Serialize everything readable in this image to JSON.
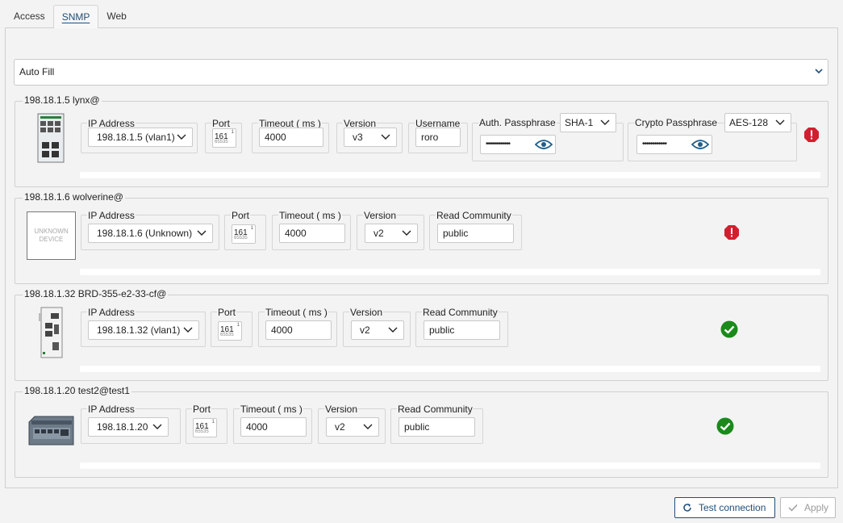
{
  "tabs": [
    {
      "label": "Access",
      "active": false
    },
    {
      "label": "SNMP",
      "active": true
    },
    {
      "label": "Web",
      "active": false
    }
  ],
  "autofill": {
    "label": "Auto Fill",
    "icon": "chevron-down-icon"
  },
  "labels": {
    "ip": "IP Address",
    "port": "Port",
    "timeout": "Timeout ( ms )",
    "version": "Version",
    "username": "Username",
    "auth": "Auth. Passphrase",
    "crypto": "Crypto Passphrase",
    "read_community": "Read Community"
  },
  "devices": [
    {
      "title": "198.18.1.5 lynx@",
      "ip": "198.18.1.5 (vlan1)",
      "port": "161",
      "port_min": "1",
      "port_max": "65535",
      "timeout": "4000",
      "version": "v3",
      "username": "roro",
      "auth_protocol": "SHA-1",
      "auth_pass": "••••••••••••",
      "crypto_protocol": "AES-128",
      "crypto_pass": "••••••••••••",
      "status": "error",
      "image": "switch-lynx-image"
    },
    {
      "title": "198.18.1.6 wolverine@",
      "ip": "198.18.1.6 (Unknown)",
      "port": "161",
      "port_min": "1",
      "port_max": "65535",
      "timeout": "4000",
      "version": "v2",
      "read_community": "public",
      "status": "error",
      "image": "unknown-device-image",
      "image_text": [
        "UNKNOWN",
        "DEVICE"
      ]
    },
    {
      "title": "198.18.1.32 BRD-355-e2-33-cf@",
      "ip": "198.18.1.32 (vlan1)",
      "port": "161",
      "port_min": "1",
      "port_max": "65535",
      "timeout": "4000",
      "version": "v2",
      "read_community": "public",
      "status": "ok",
      "image": "din-rail-device-image"
    },
    {
      "title": "198.18.1.20 test2@test1",
      "ip": "198.18.1.20",
      "port": "161",
      "port_min": "1",
      "port_max": "65535",
      "timeout": "4000",
      "version": "v2",
      "read_community": "public",
      "status": "ok",
      "image": "rugged-device-image"
    }
  ],
  "buttons": {
    "test_connection": "Test connection",
    "apply": "Apply"
  },
  "colors": {
    "accent": "#1f4e79",
    "error": "#d0202f",
    "success": "#1a8a1a",
    "eye": "#1f5f8b"
  }
}
